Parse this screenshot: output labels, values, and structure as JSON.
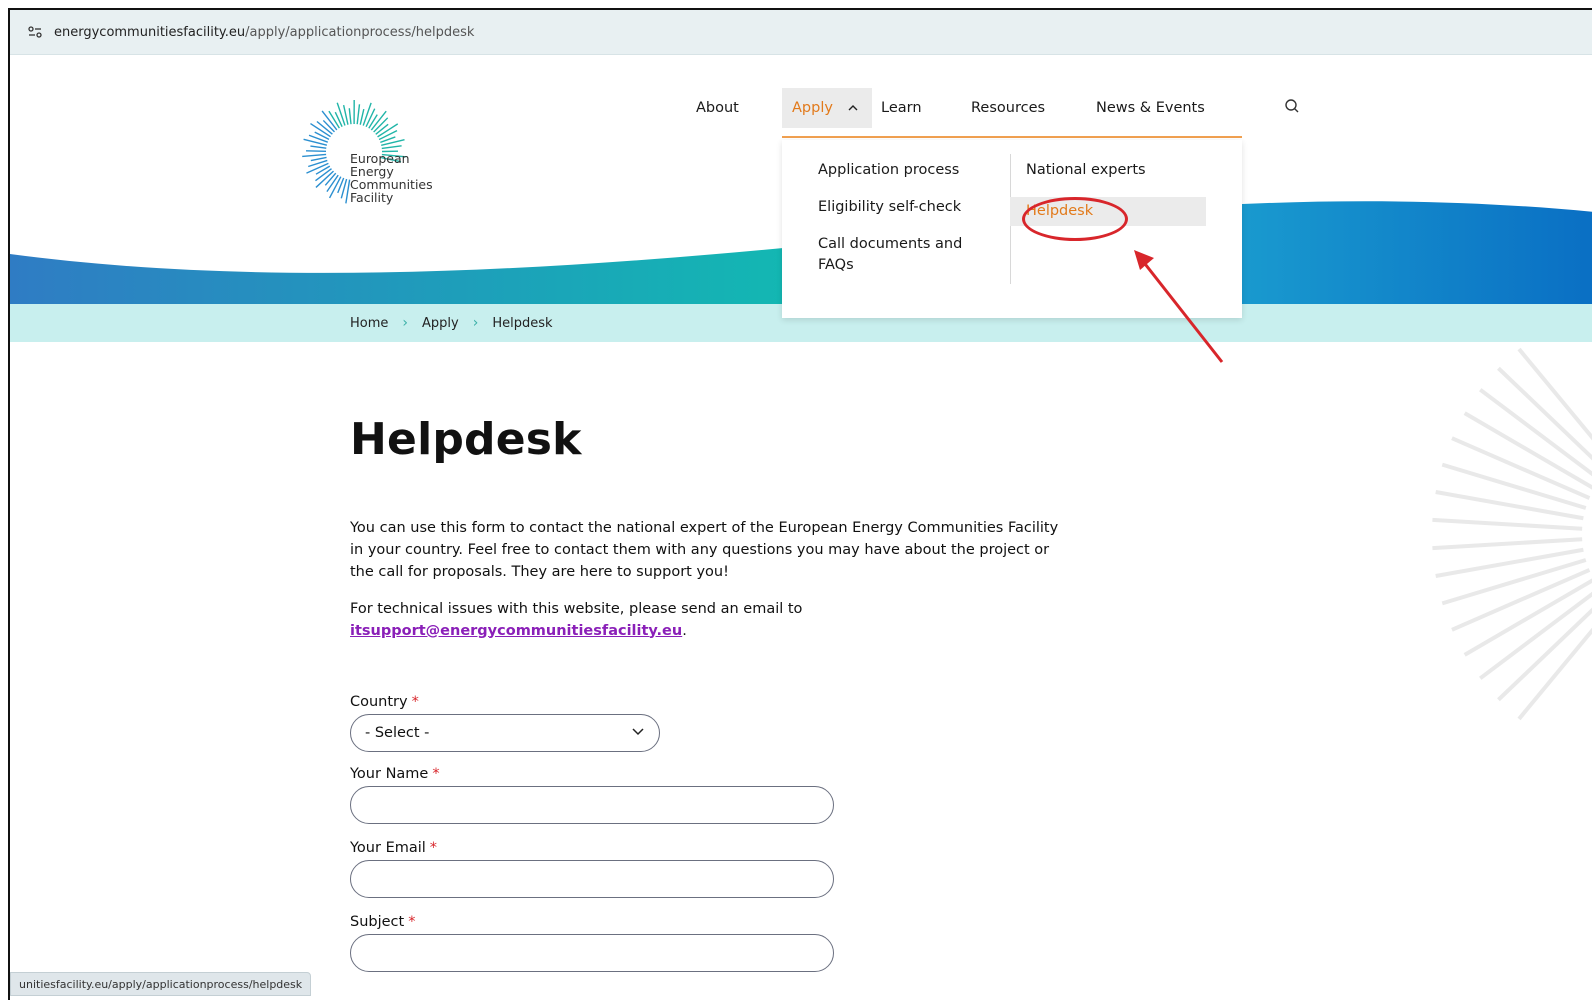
{
  "browser": {
    "url_domain": "energycommunitiesfacility.eu",
    "url_path": "/apply/applicationprocess/helpdesk",
    "status_url": "unitiesfacility.eu/apply/applicationprocess/helpdesk"
  },
  "logo": {
    "line1": "European",
    "line2": "Energy",
    "line3": "Communities",
    "line4": "Facility"
  },
  "nav": {
    "about": "About",
    "apply": "Apply",
    "learn": "Learn",
    "resources": "Resources",
    "news_events": "News & Events"
  },
  "dropdown": {
    "col1": [
      "Application process",
      "Eligibility self-check",
      "Call documents and FAQs"
    ],
    "col2": [
      "National experts",
      "Helpdesk"
    ]
  },
  "breadcrumb": {
    "home": "Home",
    "apply": "Apply",
    "current": "Helpdesk"
  },
  "main": {
    "title": "Helpdesk",
    "intro": "You can use this form to contact the national expert of the European Energy Communities Facility in your country. Feel free to contact them with any questions you may have about the project or the call for proposals. They are here to support you!",
    "tech_prefix": "For technical issues with this website, please send an email to",
    "tech_email": "itsupport@energycommunitiesfacility.eu",
    "tech_suffix": "."
  },
  "form": {
    "country_label": "Country",
    "country_value": "- Select -",
    "name_label": "Your Name",
    "email_label": "Your Email",
    "subject_label": "Subject",
    "required_mark": "*"
  },
  "colors": {
    "accent_orange": "#e27a1b",
    "link_purple": "#8a1fb8",
    "annotation_red": "#d8262b",
    "breadcrumb_bg": "#c8efee"
  }
}
